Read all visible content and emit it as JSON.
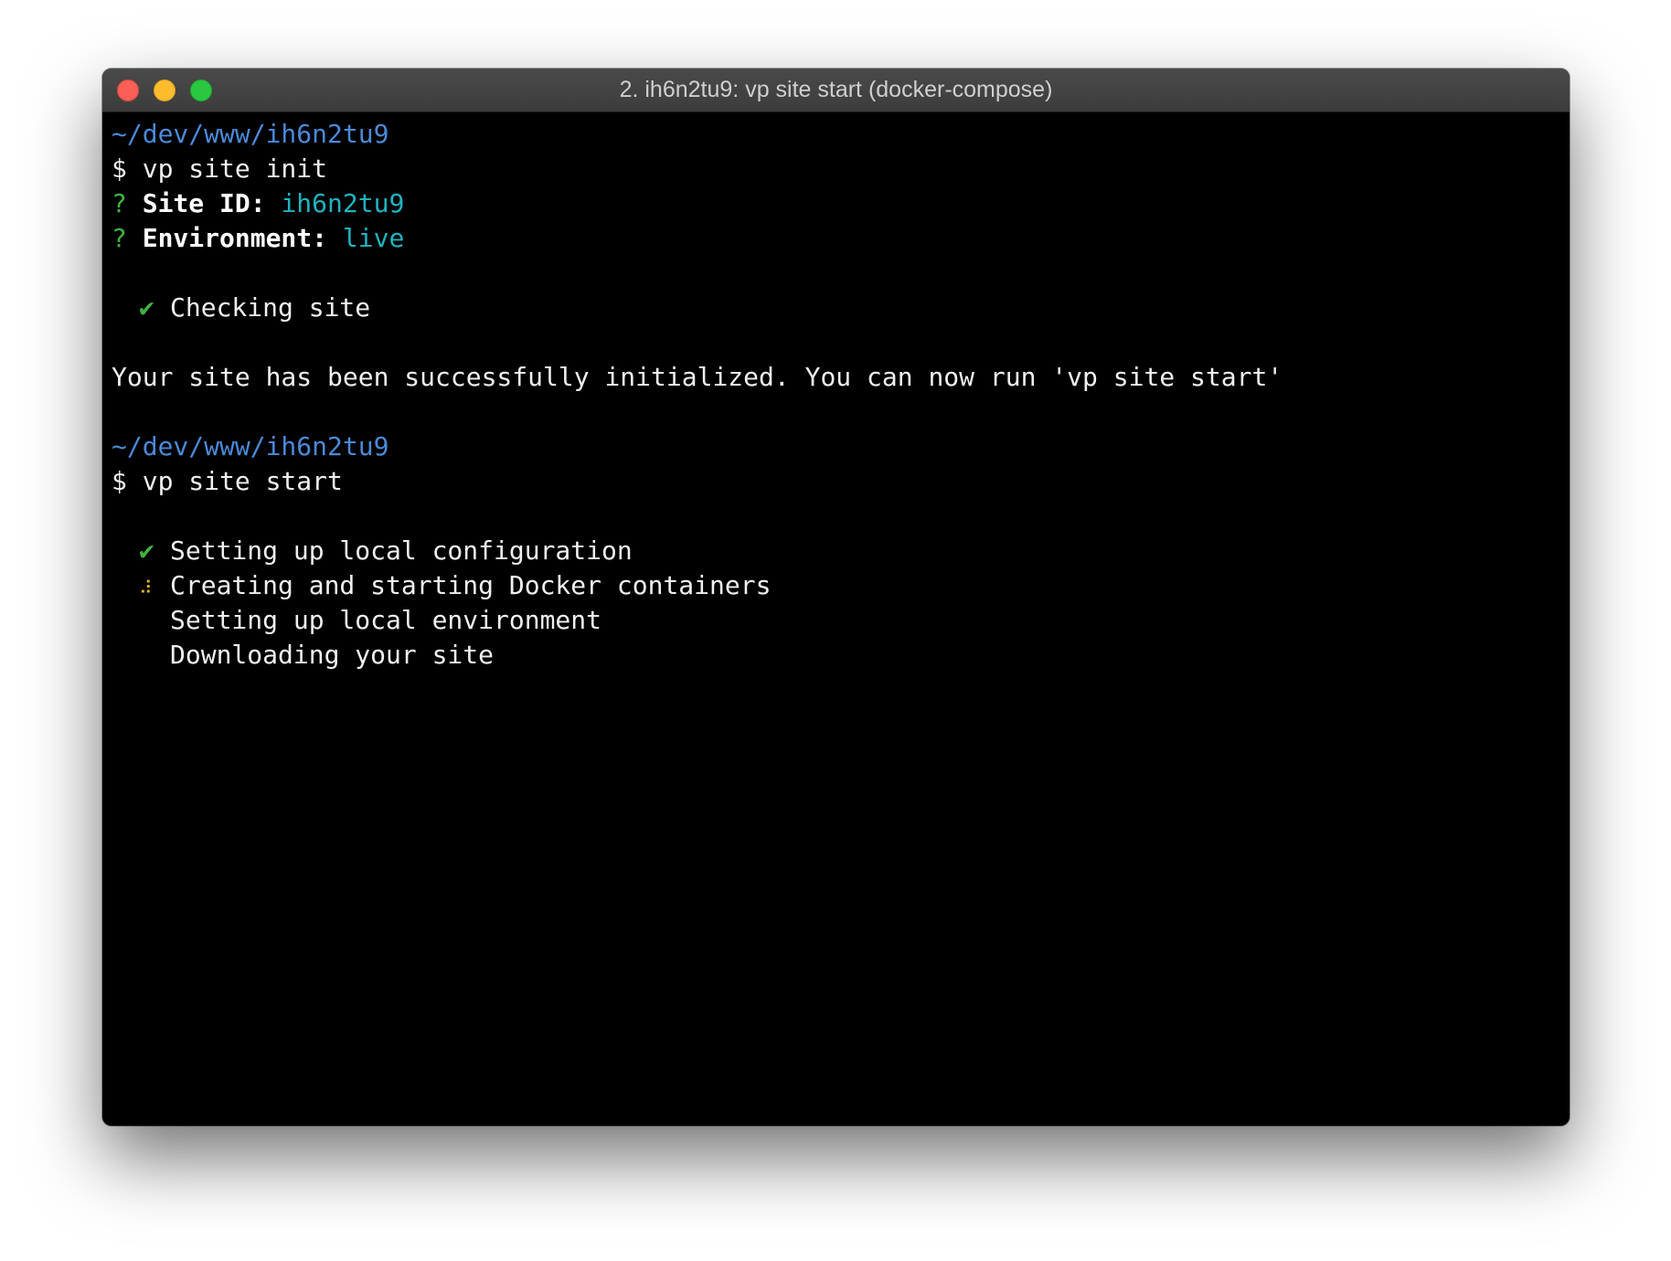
{
  "window": {
    "title": "2. ih6n2tu9: vp site start (docker-compose)"
  },
  "icons": {
    "check": "✔",
    "spinner": "⠼"
  },
  "terminal": {
    "prompt1_path": "~/dev/www/ih6n2tu9",
    "prompt1_cmd": "$ vp site init",
    "q_mark": "?",
    "site_id_label": "Site ID:",
    "site_id_value": "ih6n2tu9",
    "env_label": "Environment:",
    "env_value": "live",
    "checking": "Checking site",
    "success_msg": "Your site has been successfully initialized. You can now run 'vp site start'",
    "prompt2_path": "~/dev/www/ih6n2tu9",
    "prompt2_cmd": "$ vp site start",
    "tasks": [
      "Setting up local configuration",
      "Creating and starting Docker containers",
      "Setting up local environment",
      "Downloading your site"
    ]
  },
  "colors": {
    "path": "#4b8ad8",
    "question": "#3fb33f",
    "answer": "#20b3c0",
    "check": "#3fb33f",
    "spinner": "#e0b521"
  }
}
